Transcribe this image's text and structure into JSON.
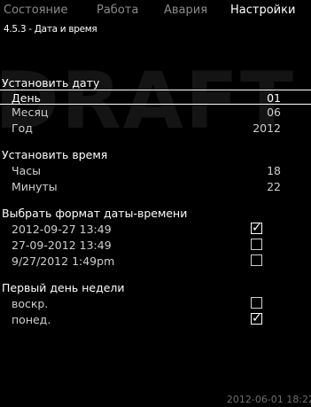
{
  "watermark": "DRAFT",
  "tabs": [
    {
      "label": "Состояние",
      "active": false
    },
    {
      "label": "Работа",
      "active": false
    },
    {
      "label": "Авария",
      "active": false
    },
    {
      "label": "Настройки",
      "active": true
    }
  ],
  "breadcrumb": "4.5.3 - Дата и время",
  "set_date": {
    "title": "Установить дату",
    "day": {
      "label": "День",
      "value": "01"
    },
    "month": {
      "label": "Месяц",
      "value": "06"
    },
    "year": {
      "label": "Год",
      "value": "2012"
    }
  },
  "set_time": {
    "title": "Установить время",
    "hours": {
      "label": "Часы",
      "value": "18"
    },
    "minutes": {
      "label": "Минуты",
      "value": "22"
    }
  },
  "format": {
    "title": "Выбрать формат даты-времени",
    "options": [
      {
        "label": "2012-09-27  13:49",
        "checked": true
      },
      {
        "label": "27-09-2012  13:49",
        "checked": false
      },
      {
        "label": "9/27/2012  1:49pm",
        "checked": false
      }
    ]
  },
  "first_day": {
    "title": "Первый день недели",
    "options": [
      {
        "label": "воскр.",
        "checked": false
      },
      {
        "label": "понед.",
        "checked": true
      }
    ]
  },
  "footer_datetime": "2012-06-01 18:22",
  "check_glyph": "✓",
  "colors": {
    "background": "#000000",
    "text": "#ffffff",
    "inactive": "#8a8a8a",
    "footer": "#6e6e6e"
  }
}
